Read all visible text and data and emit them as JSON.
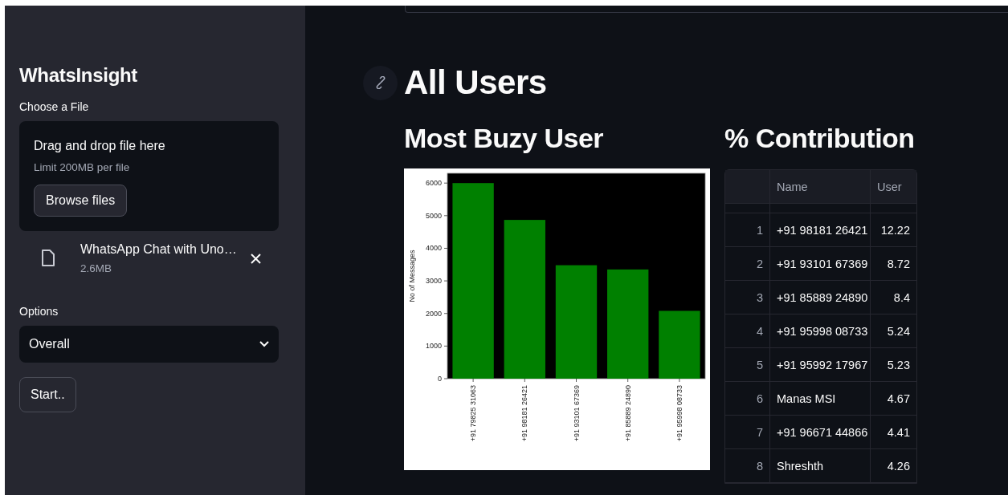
{
  "sidebar": {
    "title": "WhatsInsight",
    "uploader": {
      "label": "Choose a File",
      "drop_text": "Drag and drop file here",
      "limit_text": "Limit 200MB per file",
      "browse_button": "Browse files",
      "file": {
        "name": "WhatsApp Chat with Uno…",
        "size": "2.6MB"
      }
    },
    "options": {
      "label": "Options",
      "value": "Overall"
    },
    "start_button": "Start.."
  },
  "main": {
    "title": "All Users",
    "most_busy_user": {
      "title": "Most Buzy User",
      "chart_data": {
        "type": "bar",
        "ylabel": "No of Messages",
        "categories": [
          "+91 79825 31063",
          "+91 98181 26421",
          "+91 93101 67369",
          "+91 85889 24890",
          "+91 95998 08733"
        ],
        "series": [
          {
            "color": "#008000",
            "values": [
              6000,
              4870,
              3480,
              3350,
              2080
            ]
          }
        ],
        "ylim": [
          0,
          6300
        ],
        "yticks": [
          0,
          1000,
          2000,
          3000,
          4000,
          5000,
          6000
        ]
      }
    },
    "contribution": {
      "title": "% Contribution",
      "columns": [
        "Name",
        "User"
      ],
      "rows": [
        {
          "index": "1",
          "name": "+91 98181 26421",
          "user": "12.22"
        },
        {
          "index": "2",
          "name": "+91 93101 67369",
          "user": "8.72"
        },
        {
          "index": "3",
          "name": "+91 85889 24890",
          "user": "8.4"
        },
        {
          "index": "4",
          "name": "+91 95998 08733",
          "user": "5.24"
        },
        {
          "index": "5",
          "name": "+91 95992 17967",
          "user": "5.23"
        },
        {
          "index": "6",
          "name": "Manas MSI",
          "user": "4.67"
        },
        {
          "index": "7",
          "name": "+91 96671 44866",
          "user": "4.41"
        },
        {
          "index": "8",
          "name": "Shreshth",
          "user": "4.26"
        }
      ]
    }
  }
}
